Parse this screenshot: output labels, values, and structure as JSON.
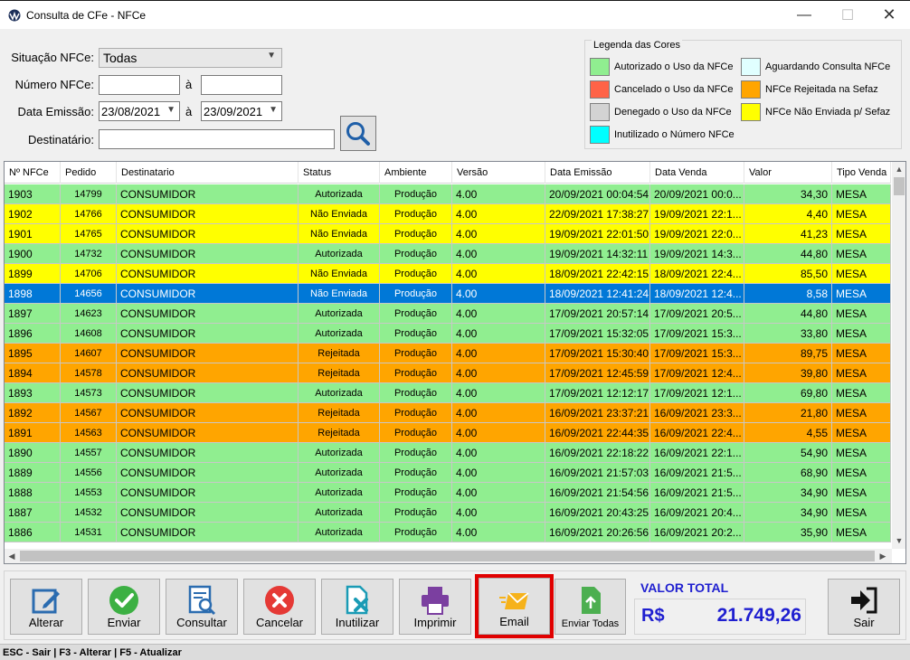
{
  "window": {
    "title": "Consulta de CFe - NFCe",
    "minimize": "—",
    "maximize": "☐",
    "close": "✕"
  },
  "filters": {
    "situacao_label": "Situação NFCe:",
    "situacao_value": "Todas",
    "numero_label": "Número NFCe:",
    "numero_from": "",
    "numero_to": "",
    "range_sep": "à",
    "data_label": "Data Emissão:",
    "data_from": "23/08/2021",
    "data_to": "23/09/2021",
    "destinatario_label": "Destinatário:",
    "destinatario_value": ""
  },
  "legend": {
    "title": "Legenda das Cores",
    "items": [
      {
        "label": "Autorizado o Uso da NFCe",
        "color": "#90ee90"
      },
      {
        "label": "Cancelado o Uso da NFCe",
        "color": "#ff6347"
      },
      {
        "label": "Denegado o Uso da NFCe",
        "color": "#d3d3d3"
      },
      {
        "label": "Inutilizado o Número NFCe",
        "color": "#00ffff"
      },
      {
        "label": "Aguardando Consulta NFCe",
        "color": "#e0ffff"
      },
      {
        "label": "NFCe Rejeitada na Sefaz",
        "color": "#ffa500"
      },
      {
        "label": "NFCe Não Enviada p/ Sefaz",
        "color": "#ffff00"
      }
    ]
  },
  "status_colors": {
    "Autorizada": "#90ee90",
    "Não Enviada": "#ffff00",
    "Rejeitada": "#ffa500",
    "selected": "#0078d7"
  },
  "grid": {
    "columns": [
      "Nº NFCe",
      "Pedido",
      "Destinatario",
      "Status",
      "Ambiente",
      "Versão",
      "Data Emissão",
      "Data Venda",
      "Valor",
      "Tipo Venda"
    ],
    "selected_row": 5,
    "rows": [
      [
        "1903",
        "14799",
        "CONSUMIDOR",
        "Autorizada",
        "Produção",
        "4.00",
        "20/09/2021 00:04:54",
        "20/09/2021 00:0...",
        "34,30",
        "MESA"
      ],
      [
        "1902",
        "14766",
        "CONSUMIDOR",
        "Não Enviada",
        "Produção",
        "4.00",
        "22/09/2021 17:38:27",
        "19/09/2021 22:1...",
        "4,40",
        "MESA"
      ],
      [
        "1901",
        "14765",
        "CONSUMIDOR",
        "Não Enviada",
        "Produção",
        "4.00",
        "19/09/2021 22:01:50",
        "19/09/2021 22:0...",
        "41,23",
        "MESA"
      ],
      [
        "1900",
        "14732",
        "CONSUMIDOR",
        "Autorizada",
        "Produção",
        "4.00",
        "19/09/2021 14:32:11",
        "19/09/2021 14:3...",
        "44,80",
        "MESA"
      ],
      [
        "1899",
        "14706",
        "CONSUMIDOR",
        "Não Enviada",
        "Produção",
        "4.00",
        "18/09/2021 22:42:15",
        "18/09/2021 22:4...",
        "85,50",
        "MESA"
      ],
      [
        "1898",
        "14656",
        "CONSUMIDOR",
        "Não Enviada",
        "Produção",
        "4.00",
        "18/09/2021 12:41:24",
        "18/09/2021 12:4...",
        "8,58",
        "MESA"
      ],
      [
        "1897",
        "14623",
        "CONSUMIDOR",
        "Autorizada",
        "Produção",
        "4.00",
        "17/09/2021 20:57:14",
        "17/09/2021 20:5...",
        "44,80",
        "MESA"
      ],
      [
        "1896",
        "14608",
        "CONSUMIDOR",
        "Autorizada",
        "Produção",
        "4.00",
        "17/09/2021 15:32:05",
        "17/09/2021 15:3...",
        "33,80",
        "MESA"
      ],
      [
        "1895",
        "14607",
        "CONSUMIDOR",
        "Rejeitada",
        "Produção",
        "4.00",
        "17/09/2021 15:30:40",
        "17/09/2021 15:3...",
        "89,75",
        "MESA"
      ],
      [
        "1894",
        "14578",
        "CONSUMIDOR",
        "Rejeitada",
        "Produção",
        "4.00",
        "17/09/2021 12:45:59",
        "17/09/2021 12:4...",
        "39,80",
        "MESA"
      ],
      [
        "1893",
        "14573",
        "CONSUMIDOR",
        "Autorizada",
        "Produção",
        "4.00",
        "17/09/2021 12:12:17",
        "17/09/2021 12:1...",
        "69,80",
        "MESA"
      ],
      [
        "1892",
        "14567",
        "CONSUMIDOR",
        "Rejeitada",
        "Produção",
        "4.00",
        "16/09/2021 23:37:21",
        "16/09/2021 23:3...",
        "21,80",
        "MESA"
      ],
      [
        "1891",
        "14563",
        "CONSUMIDOR",
        "Rejeitada",
        "Produção",
        "4.00",
        "16/09/2021 22:44:35",
        "16/09/2021 22:4...",
        "4,55",
        "MESA"
      ],
      [
        "1890",
        "14557",
        "CONSUMIDOR",
        "Autorizada",
        "Produção",
        "4.00",
        "16/09/2021 22:18:22",
        "16/09/2021 22:1...",
        "54,90",
        "MESA"
      ],
      [
        "1889",
        "14556",
        "CONSUMIDOR",
        "Autorizada",
        "Produção",
        "4.00",
        "16/09/2021 21:57:03",
        "16/09/2021 21:5...",
        "68,90",
        "MESA"
      ],
      [
        "1888",
        "14553",
        "CONSUMIDOR",
        "Autorizada",
        "Produção",
        "4.00",
        "16/09/2021 21:54:56",
        "16/09/2021 21:5...",
        "34,90",
        "MESA"
      ],
      [
        "1887",
        "14532",
        "CONSUMIDOR",
        "Autorizada",
        "Produção",
        "4.00",
        "16/09/2021 20:43:25",
        "16/09/2021 20:4...",
        "34,90",
        "MESA"
      ],
      [
        "1886",
        "14531",
        "CONSUMIDOR",
        "Autorizada",
        "Produção",
        "4.00",
        "16/09/2021 20:26:56",
        "16/09/2021 20:2...",
        "35,90",
        "MESA"
      ]
    ]
  },
  "toolbar": {
    "alterar": "Alterar",
    "enviar": "Enviar",
    "consultar": "Consultar",
    "cancelar": "Cancelar",
    "inutilizar": "Inutilizar",
    "imprimir": "Imprimir",
    "email": "Email",
    "enviar_todas": "Enviar Todas",
    "sair": "Sair"
  },
  "total": {
    "title": "VALOR TOTAL",
    "currency": "R$",
    "value": "21.749,26"
  },
  "statusbar": {
    "text": "ESC - Sair | F3 - Alterar  |  F5 - Atualizar"
  }
}
